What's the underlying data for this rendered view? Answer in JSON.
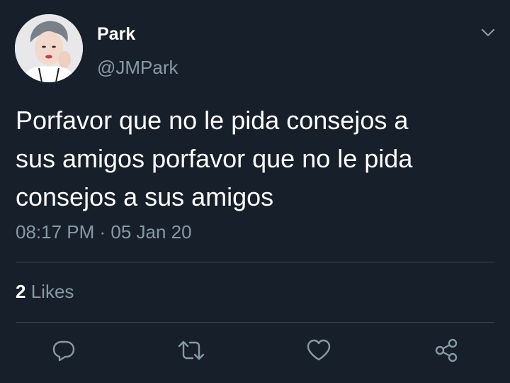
{
  "tweet": {
    "author_name": "Park",
    "author_handle": "@JMPark",
    "text": "Porfavor que no le pida consejos a\nsus amigos porfavor que no le pida\nconsejos a sus amigos",
    "timestamp": "08:17 PM · 05 Jan 20",
    "likes_count": "2",
    "likes_label": "Likes"
  },
  "actions": [
    {
      "icon": "reply-icon"
    },
    {
      "icon": "retweet-icon"
    },
    {
      "icon": "like-icon"
    },
    {
      "icon": "share-icon"
    }
  ],
  "colors": {
    "background": "#17202a",
    "primary_text": "#ffffff",
    "secondary_text": "#8899a6",
    "divider": "#38444d"
  }
}
